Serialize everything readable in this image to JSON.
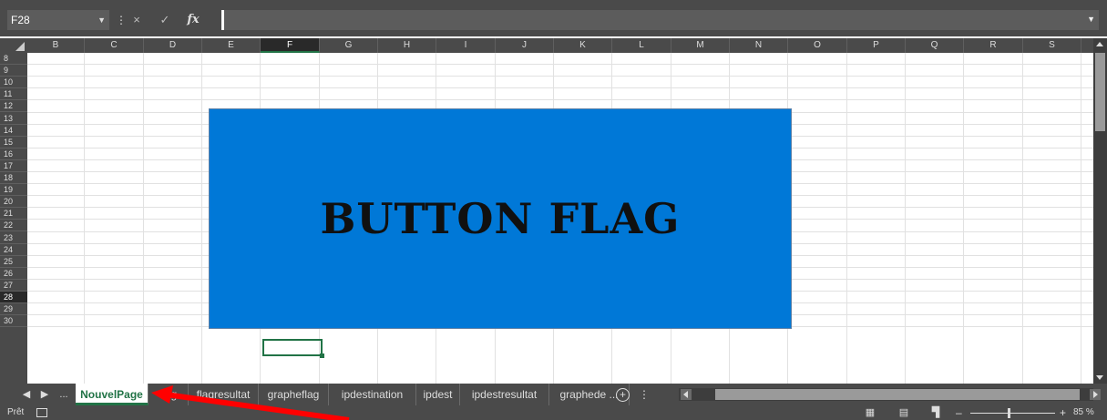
{
  "name_box": {
    "value": "F28"
  },
  "formula_bar": {
    "fx": "fx",
    "cancel": "×",
    "enter": "✓",
    "value": ""
  },
  "columns": [
    "B",
    "C",
    "D",
    "E",
    "F",
    "G",
    "H",
    "I",
    "J",
    "K",
    "L",
    "M",
    "N",
    "O",
    "P",
    "Q",
    "R",
    "S"
  ],
  "selected_column": "F",
  "rows": [
    "8",
    "9",
    "10",
    "11",
    "12",
    "13",
    "14",
    "15",
    "16",
    "17",
    "18",
    "19",
    "20",
    "21",
    "22",
    "23",
    "24",
    "25",
    "26",
    "27",
    "28",
    "29",
    "30"
  ],
  "selected_row": "28",
  "shape_button": {
    "label": "BUTTON FLAG",
    "fill": "#0078d7"
  },
  "sheet_tabs": {
    "ellipsis": "...",
    "items": [
      "NouvelPage",
      "flag",
      "flagresultat",
      "grapheflag",
      "ipdestination",
      "ipdest",
      "ipdestresultat",
      "graphede ..."
    ],
    "active": "NouvelPage",
    "add": "+"
  },
  "status": {
    "text": "Prêt",
    "zoom": "85 %",
    "zoom_minus": "–",
    "zoom_plus": "+"
  },
  "annotation": {
    "color": "#ff0000",
    "type": "red-arrow"
  },
  "colors": {
    "accent": "#217346",
    "chrome": "#4a4a4a"
  }
}
